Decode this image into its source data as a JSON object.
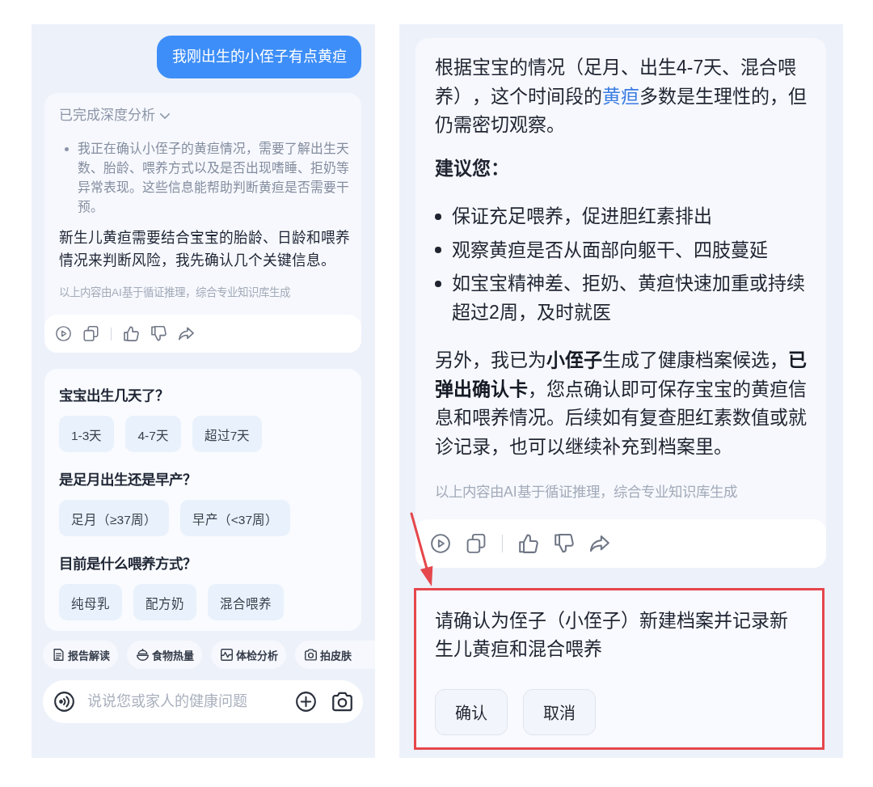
{
  "left_screen": {
    "user_message": "我刚出生的小侄子有点黄疸",
    "reply": {
      "analysis": {
        "label": "已完成深度分析",
        "expanded": true,
        "points": [
          "我正在确认小侄子的黄疸情况，需要了解出生天数、胎龄、喂养方式以及是否出现嗜睡、拒奶等异常表现。这些信息能帮助判断黄疸是否需要干预。"
        ]
      },
      "text": "新生儿黄疸需要结合宝宝的胎龄、日龄和喂养情况来判断风险，我先确认几个关键信息。",
      "disclaimer": "以上内容由AI基于循证推理，综合专业知识库生成"
    },
    "questions": [
      {
        "title": "宝宝出生几天了？",
        "options": [
          {
            "label": "1-3天",
            "selected": false
          },
          {
            "label": "4-7天",
            "selected": false
          },
          {
            "label": "超过7天",
            "selected": false
          }
        ]
      },
      {
        "title": "是足月出生还是早产？",
        "options": [
          {
            "label": "足月（≥37周）",
            "selected": false
          },
          {
            "label": "早产（<37周）",
            "selected": false
          }
        ]
      },
      {
        "title": "目前是什么喂养方式？",
        "options": [
          {
            "label": "纯母乳",
            "selected": false
          },
          {
            "label": "配方奶",
            "selected": false
          },
          {
            "label": "混合喂养",
            "selected": false
          }
        ]
      }
    ],
    "shortcuts": [
      {
        "label": "报告解读",
        "kind": "report"
      },
      {
        "label": "食物热量",
        "kind": "food"
      },
      {
        "label": "体检分析",
        "kind": "checkup"
      },
      {
        "label": "拍皮肤",
        "kind": "skin"
      }
    ],
    "input": {
      "placeholder": "说说您或家人的健康问题"
    }
  },
  "right_screen": {
    "reply": {
      "blocks": [
        {
          "kind": "paragraph",
          "segments": [
            {
              "kind": "text",
              "text": "根据宝宝的情况（足月、出生4-7天、混合喂养），这个时间段的"
            },
            {
              "kind": "link",
              "text": "黄疸"
            },
            {
              "kind": "text",
              "text": "多数是生理性的，但仍需密切观察。"
            }
          ]
        },
        {
          "kind": "heading",
          "text": "建议您："
        },
        {
          "kind": "bullets",
          "items": [
            "保证充足喂养，促进胆红素排出",
            "观察黄疸是否从面部向躯干、四肢蔓延",
            "如宝宝精神差、拒奶、黄疸快速加重或持续超过2周，及时就医"
          ]
        },
        {
          "kind": "paragraph",
          "segments": [
            {
              "kind": "text",
              "text": "另外，我已为**小侄子**生成了健康档案候选，**已弹出确认卡**，您点确认即可保存宝宝的黄疸信息和喂养情况。后续如有复查胆红素数值或就诊记录，也可以继续补充到档案里。"
            }
          ]
        }
      ],
      "disclaimer": "以上内容由AI基于循证推理，综合专业知识库生成"
    },
    "confirm_card": {
      "text": "请确认为侄子（小侄子）新建档案并记录新生儿黄疸和混合喂养",
      "buttons": [
        "确认",
        "取消"
      ]
    }
  }
}
